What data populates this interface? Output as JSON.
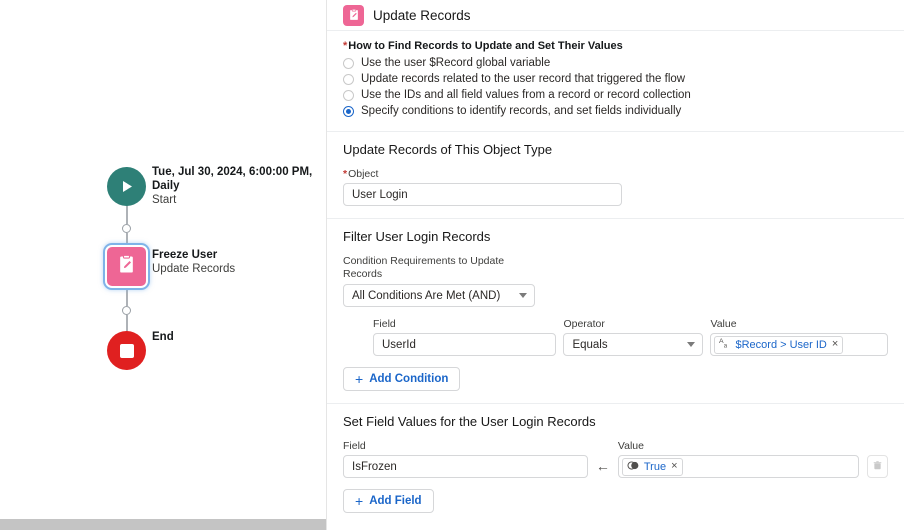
{
  "canvas": {
    "start_node": {
      "icon": "play-icon",
      "title": "Tue, Jul 30, 2024, 6:00:00 PM, Daily",
      "subtitle": "Start"
    },
    "update_node": {
      "icon": "update-records-icon",
      "title": "Freeze User",
      "subtitle": "Update Records"
    },
    "end_node": {
      "icon": "stop-icon",
      "label": "End"
    }
  },
  "panel": {
    "header": {
      "icon": "update-records-icon",
      "title": "Update Records"
    },
    "how_to_find": {
      "legend": "How to Find Records to Update and Set Their Values",
      "required": true,
      "options": [
        {
          "label": "Use the user $Record global variable",
          "selected": false
        },
        {
          "label": "Update records related to the user record that triggered the flow",
          "selected": false
        },
        {
          "label": "Use the IDs and all field values from a record or record collection",
          "selected": false
        },
        {
          "label": "Specify conditions to identify records, and set fields individually",
          "selected": true
        }
      ]
    },
    "object_section": {
      "title": "Update Records of This Object Type",
      "object_label": "Object",
      "object_required": true,
      "object_value": "User Login"
    },
    "filter_section": {
      "title": "Filter User Login Records",
      "condition_requirements_label": "Condition Requirements to Update Records",
      "condition_requirements_value": "All Conditions Are Met (AND)",
      "columns": {
        "field": "Field",
        "operator": "Operator",
        "value": "Value"
      },
      "condition": {
        "field": "UserId",
        "operator": "Equals",
        "value_pill_icon": "text-type-icon",
        "value_pill_text": "$Record > User ID",
        "value_pill_remove": "×"
      },
      "add_condition_label": "Add Condition",
      "add_icon": "plus-icon"
    },
    "set_fields_section": {
      "title": "Set Field Values for the User Login Records",
      "columns": {
        "field": "Field",
        "value": "Value"
      },
      "row": {
        "field": "IsFrozen",
        "assign_icon": "arrow-left-icon",
        "value_pill_icon": "boolean-type-icon",
        "value_pill_text": "True",
        "value_pill_remove": "×",
        "delete_icon": "trash-icon"
      },
      "add_field_label": "Add Field",
      "add_icon": "plus-icon"
    }
  },
  "colors": {
    "start_node": "#2e8077",
    "update_node": "#ee6695",
    "end_node": "#e02020",
    "link": "#1b66c9",
    "required": "#c23934",
    "selection_ring": "#7fb3e8"
  }
}
